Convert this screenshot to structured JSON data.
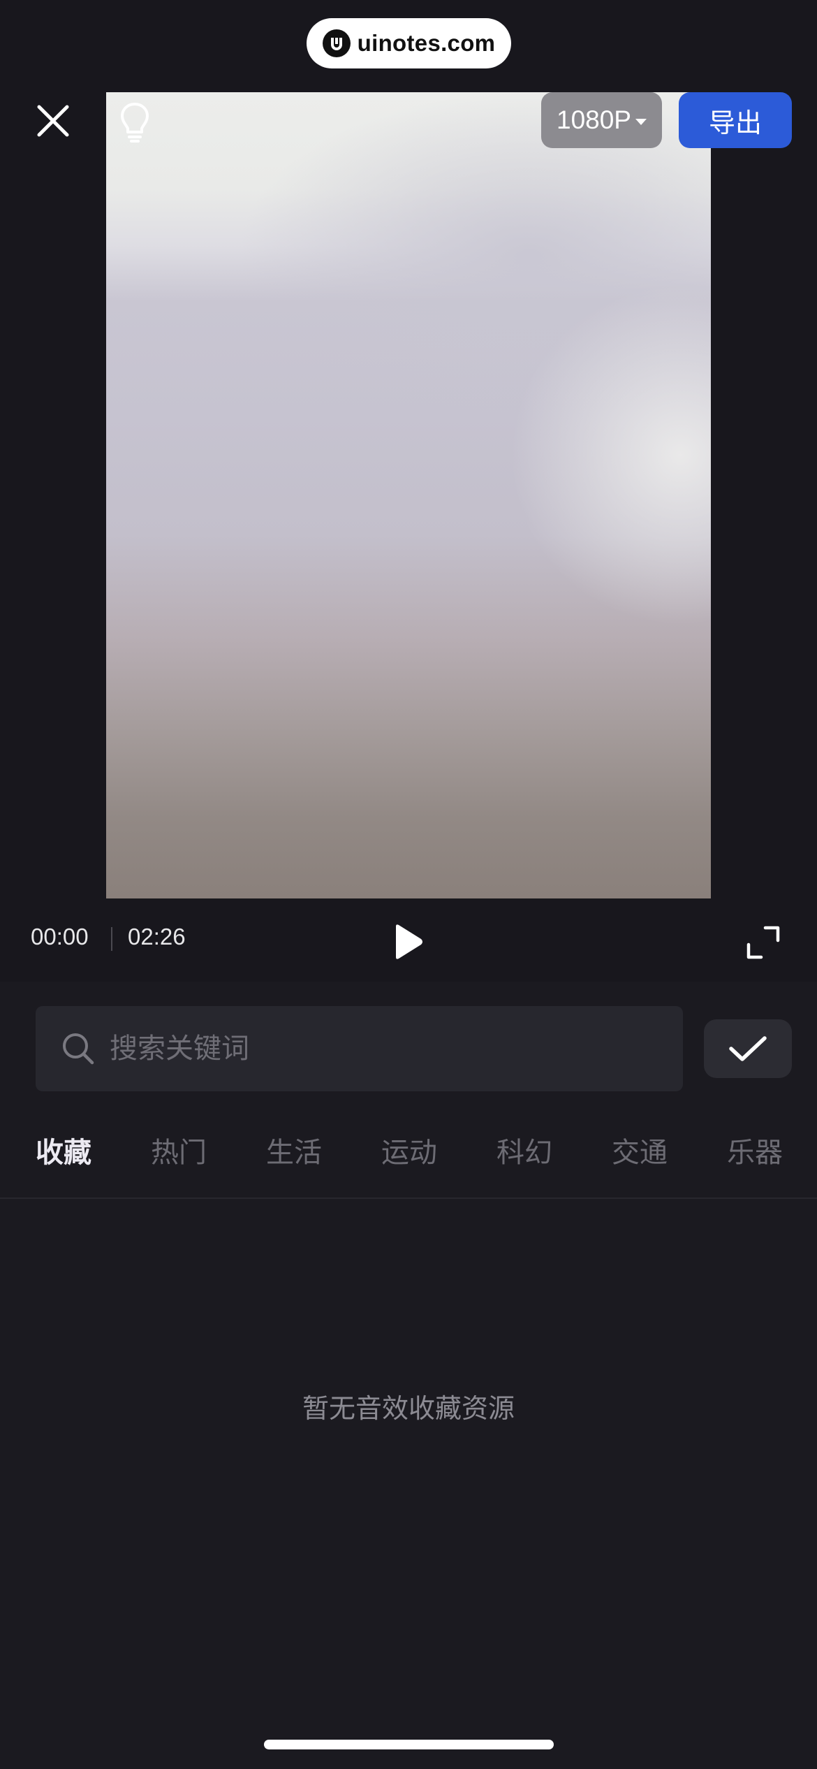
{
  "watermark": {
    "text": "uinotes.com",
    "logo_icon": "u-logo-icon"
  },
  "toolbar": {
    "close_icon": "close-icon",
    "tips_icon": "lightbulb-icon",
    "resolution_label": "1080P",
    "export_label": "导出",
    "export_color": "#2c5bd8"
  },
  "player": {
    "current_time": "00:00",
    "total_time": "02:26",
    "play_icon": "play-icon",
    "fullscreen_icon": "fullscreen-icon"
  },
  "search": {
    "placeholder": "搜索关键词",
    "value": "",
    "confirm_icon": "checkmark-icon"
  },
  "tabs": [
    {
      "label": "收藏",
      "active": true
    },
    {
      "label": "热门",
      "active": false
    },
    {
      "label": "生活",
      "active": false
    },
    {
      "label": "运动",
      "active": false
    },
    {
      "label": "科幻",
      "active": false
    },
    {
      "label": "交通",
      "active": false
    },
    {
      "label": "乐器",
      "active": false
    }
  ],
  "empty_state": {
    "message": "暂无音效收藏资源"
  }
}
